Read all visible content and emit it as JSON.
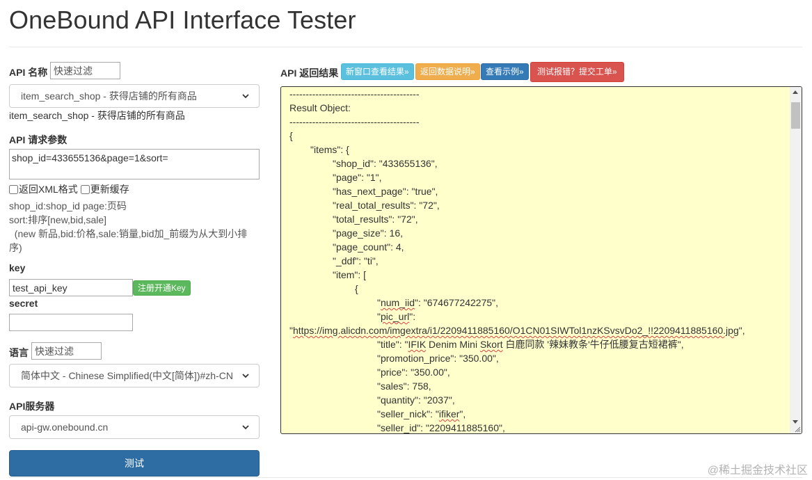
{
  "header": {
    "title": "OneBound API Interface Tester"
  },
  "api_name": {
    "label": "API 名称",
    "filter_placeholder": "快速过滤",
    "selected": "item_search_shop - 获得店铺的所有商品",
    "description": "item_search_shop - 获得店铺的所有商品"
  },
  "params": {
    "label": "API 请求参数",
    "value": "shop_id=433655136&page=1&sort=",
    "xml_label": "返回XML格式",
    "cache_label": "更新缓存",
    "help": [
      "shop_id:shop_id page:页码",
      "sort:排序[new,bid,sale]",
      "  (new 新品,bid:价格,sale:销量,bid加_前缀为从大到小排",
      "序)"
    ]
  },
  "key": {
    "label": "key",
    "value": "test_api_key",
    "register_button": "注册开通Key"
  },
  "secret": {
    "label": "secret",
    "value": ""
  },
  "language": {
    "label": "语言",
    "filter_placeholder": "快速过滤",
    "selected": "简体中文 - Chinese Simplified(中文[简体])#zh-CN"
  },
  "server": {
    "label": "API服务器",
    "selected": "api-gw.onebound.cn"
  },
  "test_button": "测试",
  "result": {
    "label": "API 返回结果",
    "buttons": {
      "new_window": "新窗口查看结果»",
      "data_doc": "返回数据说明»",
      "example": "查看示例»",
      "report": "测试报错？提交工单»"
    },
    "lines": [
      {
        "indent": 0,
        "segments": [
          {
            "t": "----------------------------------------"
          }
        ]
      },
      {
        "indent": 0,
        "segments": [
          {
            "t": "Result Object:"
          }
        ]
      },
      {
        "indent": 0,
        "segments": [
          {
            "t": "----------------------------------------"
          }
        ]
      },
      {
        "indent": 0,
        "segments": [
          {
            "t": "{"
          }
        ]
      },
      {
        "indent": 1,
        "segments": [
          {
            "t": "\"items\": {"
          }
        ]
      },
      {
        "indent": 2,
        "segments": [
          {
            "t": "\"shop_id\": \"433655136\","
          }
        ]
      },
      {
        "indent": 2,
        "segments": [
          {
            "t": "\"page\": \"1\","
          }
        ]
      },
      {
        "indent": 2,
        "segments": [
          {
            "t": "\"has_next_page\": \"true\","
          }
        ]
      },
      {
        "indent": 2,
        "segments": [
          {
            "t": "\"real_total_results\": \"72\","
          }
        ]
      },
      {
        "indent": 2,
        "segments": [
          {
            "t": "\"total_results\": \"72\","
          }
        ]
      },
      {
        "indent": 2,
        "segments": [
          {
            "t": "\"page_size\": 16,"
          }
        ]
      },
      {
        "indent": 2,
        "segments": [
          {
            "t": "\"page_count\": 4,"
          }
        ]
      },
      {
        "indent": 2,
        "segments": [
          {
            "t": "\"_ddf\": \"ti\","
          }
        ]
      },
      {
        "indent": 2,
        "segments": [
          {
            "t": "\"item\": ["
          }
        ]
      },
      {
        "indent": 3,
        "segments": [
          {
            "t": "{"
          }
        ]
      },
      {
        "indent": 4,
        "segments": [
          {
            "t": "\""
          },
          {
            "t": "num_iid",
            "u": true
          },
          {
            "t": "\": \"674677242275\","
          }
        ]
      },
      {
        "indent": 4,
        "segments": [
          {
            "t": "\""
          },
          {
            "t": "pic_url",
            "u": true
          },
          {
            "t": "\":"
          }
        ]
      },
      {
        "indent": 0,
        "segments": [
          {
            "t": "\""
          },
          {
            "t": "https://img.alicdn.com/imgextra/i1/2209411885160/O1CN01SIWTol1nzKSvsvDo2_!!2209411885160.jpg",
            "u": true
          },
          {
            "t": "\","
          }
        ]
      },
      {
        "indent": 4,
        "segments": [
          {
            "t": "\"title\": \""
          },
          {
            "t": "IFIK",
            "u": true
          },
          {
            "t": " Denim Mini "
          },
          {
            "t": "Skort",
            "u": true
          },
          {
            "t": " 白鹿同款 '辣妹教条'牛仔低腰复古短裙裤\","
          }
        ]
      },
      {
        "indent": 4,
        "segments": [
          {
            "t": "\"promotion_price\": \"350.00\","
          }
        ]
      },
      {
        "indent": 4,
        "segments": [
          {
            "t": "\"price\": \"350.00\","
          }
        ]
      },
      {
        "indent": 4,
        "segments": [
          {
            "t": "\"sales\": 758,"
          }
        ]
      },
      {
        "indent": 4,
        "segments": [
          {
            "t": "\"quantity\": \"2037\","
          }
        ]
      },
      {
        "indent": 4,
        "segments": [
          {
            "t": "\"seller_nick\": \""
          },
          {
            "t": "ifiker",
            "u": true
          },
          {
            "t": "\","
          }
        ]
      },
      {
        "indent": 4,
        "segments": [
          {
            "t": "\"seller_id\": \"2209411885160\","
          }
        ]
      }
    ]
  },
  "watermark": "@稀土掘金技术社区",
  "colors": {
    "result_bg": "#ffffcc",
    "test_button": "#2e6da4",
    "btn_info": "#5bc0de",
    "btn_warning": "#f0ad4e",
    "btn_primary": "#337ab7",
    "btn_danger": "#d9534f",
    "btn_success": "#5cb85c"
  },
  "icons": [
    "chevron-down-icon",
    "scroll-up-arrow-icon",
    "scroll-down-arrow-icon",
    "resize-grip-icon"
  ]
}
